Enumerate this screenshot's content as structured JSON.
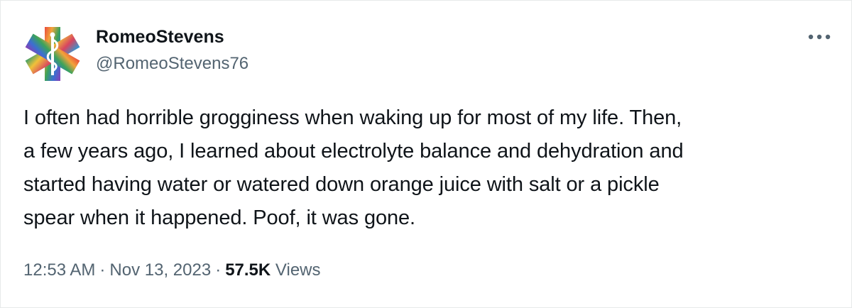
{
  "author": {
    "display_name": "RomeoStevens",
    "handle": "@RomeoStevens76"
  },
  "avatar": {
    "icon": "star-of-life-icon"
  },
  "more_menu": {
    "icon": "more-dots-icon"
  },
  "tweet": {
    "text": "I often had horrible grogginess when waking up for most of my life. Then,\na few years ago, I learned about electrolyte balance and dehydration and\nstarted having water or watered down orange juice with salt or a pickle\nspear when it happened. Poof, it was gone."
  },
  "meta": {
    "time": "12:53 AM",
    "separator": "·",
    "date": "Nov 13, 2023",
    "views_count": "57.5K",
    "views_label": "Views"
  },
  "colors": {
    "text_primary": "#0f1419",
    "text_secondary": "#536471",
    "border": "#e7e9ea"
  }
}
